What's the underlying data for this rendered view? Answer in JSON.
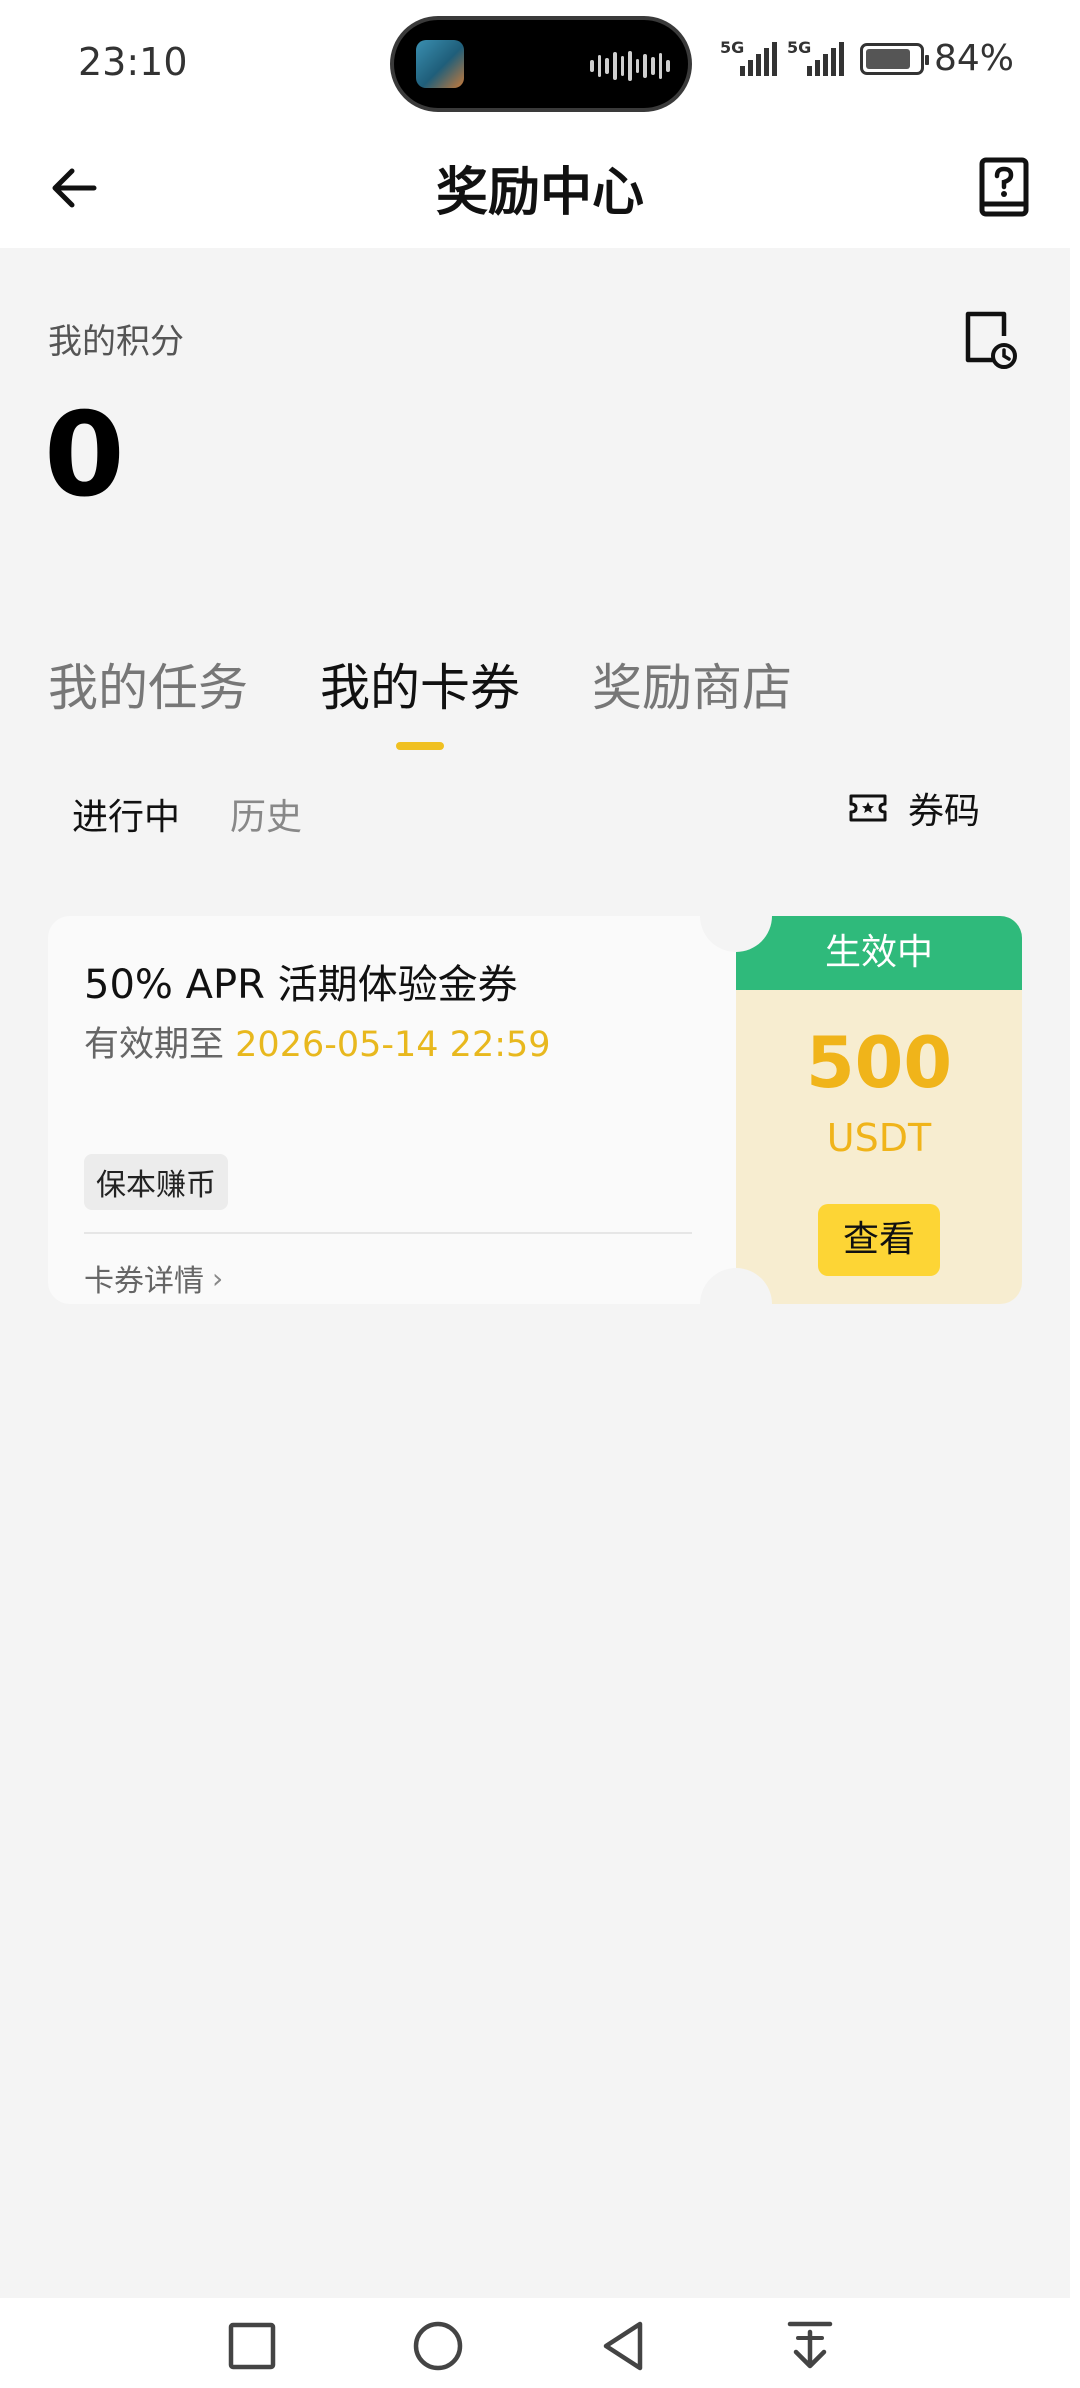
{
  "status_bar": {
    "time": "23:10",
    "signal_label": "5G",
    "battery": "84%",
    "battery_level": 0.84
  },
  "header": {
    "title": "奖励中心",
    "back_icon": "arrow-left-icon",
    "help_icon": "question-book-icon"
  },
  "points": {
    "label": "我的积分",
    "value": "0",
    "history_icon": "document-clock-icon"
  },
  "tabs": [
    {
      "label": "我的任务",
      "active": false
    },
    {
      "label": "我的卡券",
      "active": true
    },
    {
      "label": "奖励商店",
      "active": false
    }
  ],
  "subtabs": [
    {
      "label": "进行中",
      "active": true
    },
    {
      "label": "历史",
      "active": false
    }
  ],
  "voucher_code": {
    "label": "券码",
    "icon": "ticket-icon"
  },
  "coupon": {
    "title": "50% APR 活期体验金券",
    "validity_prefix": "有效期至",
    "validity_date": "2026-05-14 22:59",
    "tag": "保本赚币",
    "detail_link": "卡券详情",
    "status": "生效中",
    "amount": "500",
    "unit": "USDT",
    "view_button": "查看",
    "colors": {
      "status_green": "#2fba7b",
      "amount_gold": "#f0b41a",
      "button_yellow": "#fdd535"
    }
  },
  "navbar": {
    "icons": [
      "square-recents-icon",
      "circle-home-icon",
      "triangle-back-icon",
      "down-arrow-tray-icon"
    ]
  }
}
